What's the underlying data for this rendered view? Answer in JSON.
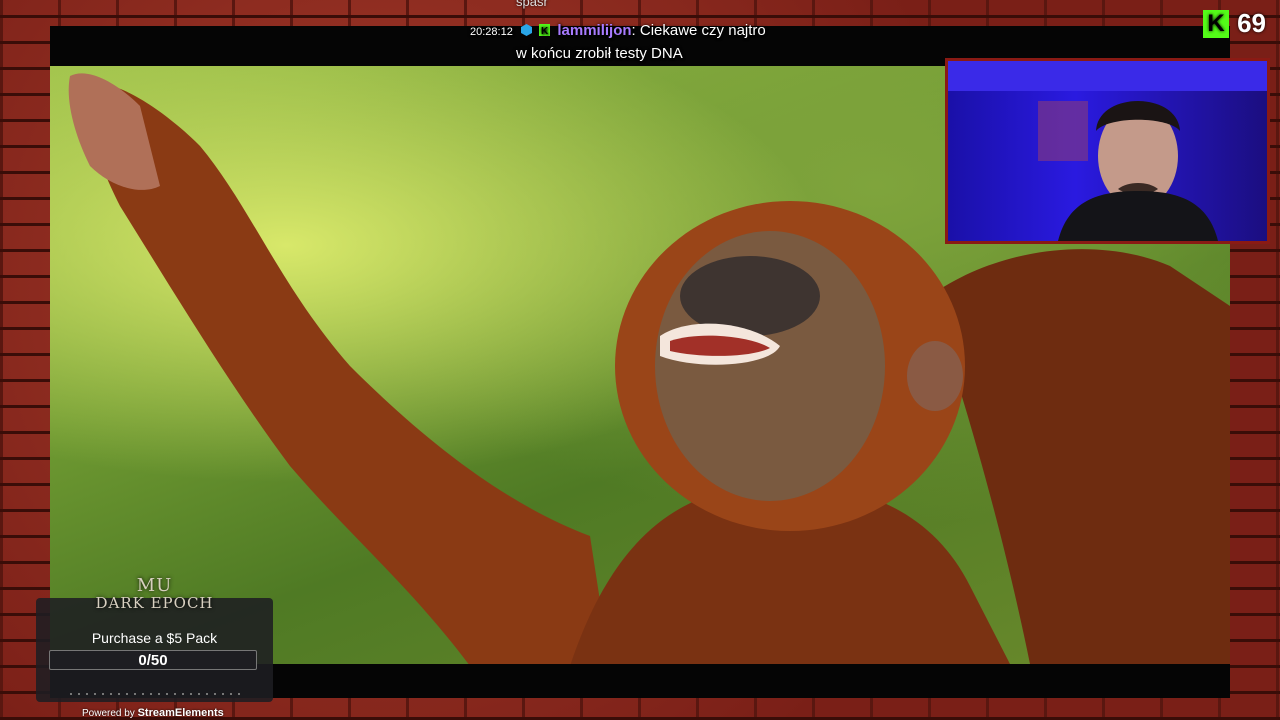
{
  "chat": {
    "previous_text": "spasr",
    "timestamp": "20:28:12",
    "username": "lammilijon",
    "message_line1": ": Ciekawe czy najtro",
    "message_line2": "w końcu zrobił testy DNA"
  },
  "viewer_counter": {
    "icon": "K",
    "count": "69"
  },
  "goal_widget": {
    "logo_line1": "MU",
    "logo_line2": "DARK EPOCH",
    "title": "Purchase a $5 Pack",
    "progress_text": "0/50",
    "progress_fraction": 0,
    "powered_prefix": "Powered by",
    "powered_brand": "StreamElements"
  },
  "colors": {
    "kick_green": "#53fc18",
    "username_purple": "#a87bff",
    "webcam_blue": "#2a1ae0"
  }
}
